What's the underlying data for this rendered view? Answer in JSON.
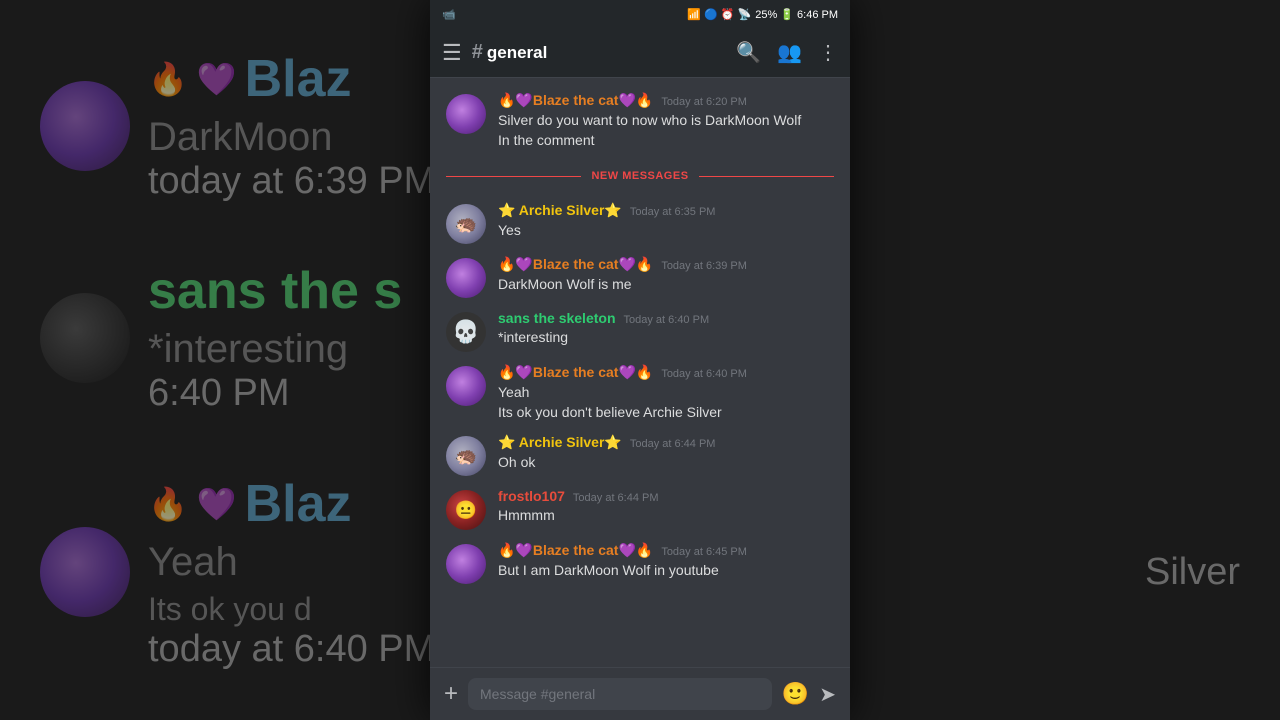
{
  "statusBar": {
    "left": "📹",
    "right": "25% 🔋 6:46 PM"
  },
  "header": {
    "menuIcon": "☰",
    "channelHash": "#",
    "channelName": "general",
    "searchIcon": "🔍",
    "membersIcon": "👥",
    "moreIcon": "⋮"
  },
  "messages": [
    {
      "id": "msg1",
      "username": "🔥💜Blaze the cat💜🔥",
      "usernameClass": "username-blaze",
      "avatarClass": "avatar-blaze",
      "avatarEmoji": "",
      "timestamp": "Today at 6:20 PM",
      "lines": [
        "Silver do you want to now who is DarkMoon Wolf",
        "In the comment"
      ]
    }
  ],
  "divider": {
    "label": "NEW MESSAGES"
  },
  "messagesAfterDivider": [
    {
      "id": "msg2",
      "username": "⭐ Archie Silver⭐",
      "usernameClass": "username-silver",
      "avatarClass": "avatar-silver",
      "avatarEmoji": "",
      "timestamp": "Today at 6:35 PM",
      "lines": [
        "Yes"
      ]
    },
    {
      "id": "msg3",
      "username": "🔥💜Blaze the cat💜🔥",
      "usernameClass": "username-blaze",
      "avatarClass": "avatar-blaze",
      "avatarEmoji": "",
      "timestamp": "Today at 6:39 PM",
      "lines": [
        "DarkMoon Wolf is me"
      ]
    },
    {
      "id": "msg4",
      "username": "sans the skeleton",
      "usernameClass": "username-sans",
      "avatarClass": "avatar-sans",
      "avatarEmoji": "",
      "timestamp": "Today at 6:40 PM",
      "lines": [
        "*interesting"
      ]
    },
    {
      "id": "msg5",
      "username": "🔥💜Blaze the cat💜🔥",
      "usernameClass": "username-blaze",
      "avatarClass": "avatar-blaze",
      "avatarEmoji": "",
      "timestamp": "Today at 6:40 PM",
      "lines": [
        "Yeah",
        "Its ok you don't believe Archie Silver"
      ]
    },
    {
      "id": "msg6",
      "username": "⭐ Archie Silver⭐",
      "usernameClass": "username-silver",
      "avatarClass": "avatar-silver",
      "avatarEmoji": "",
      "timestamp": "Today at 6:44 PM",
      "lines": [
        "Oh ok"
      ]
    },
    {
      "id": "msg7",
      "username": "frostlo107",
      "usernameClass": "username-frost",
      "avatarClass": "avatar-frost",
      "avatarEmoji": "",
      "timestamp": "Today at 6:44 PM",
      "lines": [
        "Hmmmm"
      ]
    },
    {
      "id": "msg8",
      "username": "🔥💜Blaze the cat💜🔥",
      "usernameClass": "username-blaze",
      "avatarClass": "avatar-blaze",
      "avatarEmoji": "",
      "timestamp": "Today at 6:45 PM",
      "lines": [
        "But I am DarkMoon Wolf in youtube"
      ]
    }
  ],
  "inputBar": {
    "placeholder": "Message #general",
    "addIcon": "+",
    "emojiIcon": "🙂",
    "sendIcon": "➤"
  },
  "background": {
    "rows": [
      {
        "type": "blaze",
        "emojis": "🔥 💜",
        "name": "Blaze",
        "textLine1": "DarkMoon",
        "textLine2": "today at 6:39 PM"
      },
      {
        "type": "sans",
        "name": "sans the s",
        "textLine1": "*interesting",
        "textLine2": "6:40 PM"
      },
      {
        "type": "blaze",
        "emojis": "🔥 💜",
        "name": "Blaz",
        "textLine1": "Yeah",
        "textLine2": "today at 6:40 PM"
      }
    ]
  }
}
